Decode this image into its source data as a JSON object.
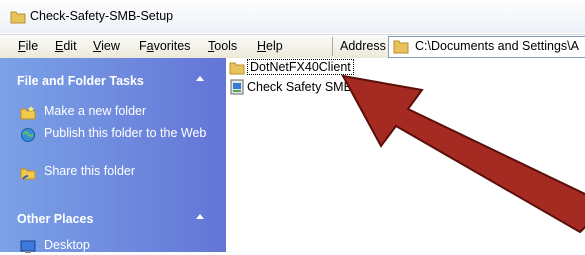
{
  "window": {
    "title": "Check-Safety-SMB-Setup"
  },
  "menu": {
    "items": [
      {
        "u": "F",
        "rest": "ile"
      },
      {
        "u": "E",
        "rest": "dit"
      },
      {
        "u": "V",
        "rest": "iew"
      },
      {
        "pre": "F",
        "u": "a",
        "rest": "vorites"
      },
      {
        "u": "T",
        "rest": "ools"
      },
      {
        "u": "H",
        "rest": "elp"
      }
    ]
  },
  "address": {
    "label": "Address",
    "value": "C:\\Documents and Settings\\A"
  },
  "taskpane": {
    "file_tasks": {
      "title": "File and Folder Tasks",
      "items": [
        "Make a new folder",
        "Publish this folder to the Web",
        "Share this folder"
      ]
    },
    "other_places": {
      "title": "Other Places",
      "items": [
        "Desktop"
      ]
    }
  },
  "files": [
    {
      "name": "DotNetFX40Client",
      "icon": "folder-icon",
      "selected": true
    },
    {
      "name": "Check Safety SMB Se",
      "icon": "setup-icon",
      "selected": false
    }
  ],
  "colors": {
    "arrow": "#a52a22",
    "taskpane": "#6b8be0",
    "link": "#0b2fa8"
  }
}
